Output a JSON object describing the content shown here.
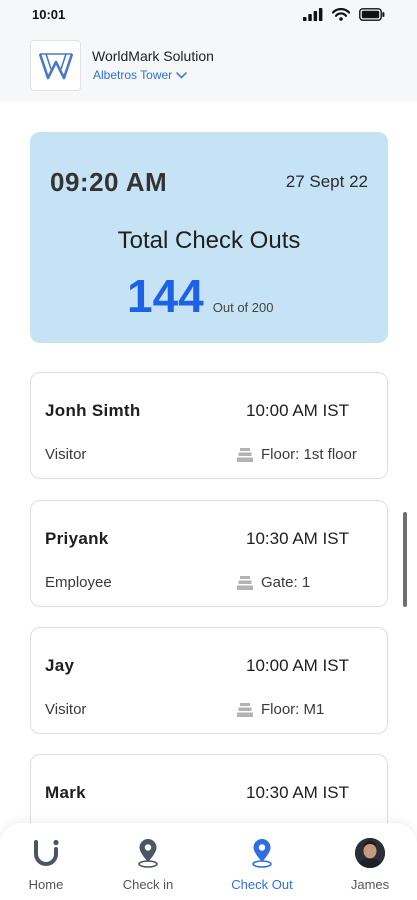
{
  "status_bar": {
    "time": "10:01"
  },
  "header": {
    "company": "WorldMark Solution",
    "location": "Albetros Tower"
  },
  "summary": {
    "time": "09:20 AM",
    "date": "27 Sept 22",
    "title": "Total Check Outs",
    "count": "144",
    "out_of": "Out of 200"
  },
  "visits": [
    {
      "name": "Jonh Simth",
      "time": "10:00 AM IST",
      "type": "Visitor",
      "location": "Floor: 1st floor"
    },
    {
      "name": "Priyank",
      "time": "10:30 AM IST",
      "type": "Employee",
      "location": "Gate: 1"
    },
    {
      "name": "Jay",
      "time": "10:00 AM IST",
      "type": "Visitor",
      "location": "Floor: M1"
    },
    {
      "name": "Mark",
      "time": "10:30 AM IST",
      "type": "",
      "location": ""
    }
  ],
  "nav": {
    "items": [
      {
        "label": "Home",
        "icon": "home-u-icon"
      },
      {
        "label": "Check in",
        "icon": "location-pin-icon"
      },
      {
        "label": "Check Out",
        "icon": "location-pin-icon"
      },
      {
        "label": "James",
        "icon": "avatar"
      }
    ],
    "active": "Check Out"
  },
  "colors": {
    "accent": "#1c62e6",
    "card_bg": "#c6e3f6",
    "link": "#2f6fe4"
  }
}
